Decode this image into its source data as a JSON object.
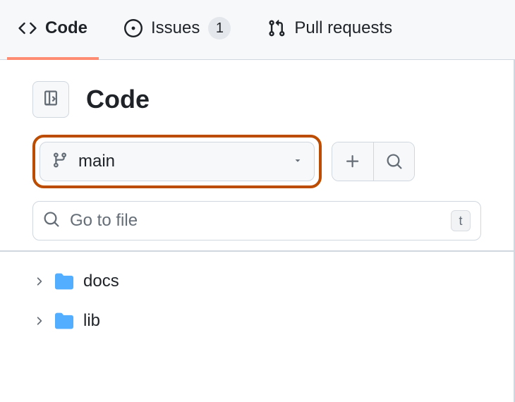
{
  "tabs": {
    "code": {
      "label": "Code"
    },
    "issues": {
      "label": "Issues",
      "count": "1"
    },
    "pull_requests": {
      "label": "Pull requests"
    }
  },
  "header": {
    "title": "Code"
  },
  "branch": {
    "name": "main"
  },
  "file_search": {
    "placeholder": "Go to file",
    "kbd": "t"
  },
  "tree": {
    "items": [
      {
        "label": "docs"
      },
      {
        "label": "lib"
      }
    ]
  }
}
